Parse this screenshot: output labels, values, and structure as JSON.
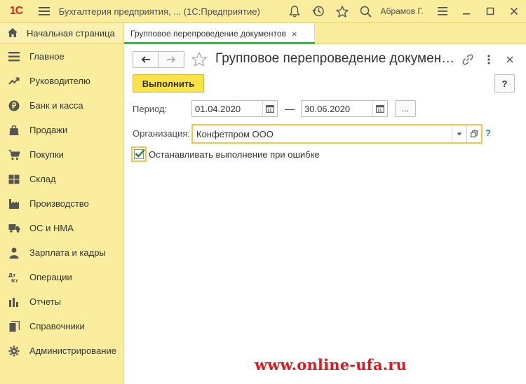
{
  "titlebar": {
    "logo": "1С",
    "title": "Бухгалтерия предприятия, ...  (1С:Предприятие)",
    "user": "Абрамов Г.",
    "icons": [
      "menu-icon",
      "bell-icon",
      "history-icon",
      "star-icon",
      "search-icon"
    ],
    "window_buttons": [
      "settings-icon",
      "minimize-icon",
      "maximize-icon",
      "close-icon"
    ]
  },
  "sidebar": {
    "home_label": "Начальная страница",
    "items": [
      {
        "label": "Главное",
        "icon": "list-icon"
      },
      {
        "label": "Руководителю",
        "icon": "trend-icon"
      },
      {
        "label": "Банк и касса",
        "icon": "ruble-icon"
      },
      {
        "label": "Продажи",
        "icon": "bag-icon"
      },
      {
        "label": "Покупки",
        "icon": "cart-icon"
      },
      {
        "label": "Склад",
        "icon": "warehouse-icon"
      },
      {
        "label": "Производство",
        "icon": "factory-icon"
      },
      {
        "label": "ОС и НМА",
        "icon": "truck-icon"
      },
      {
        "label": "Зарплата и кадры",
        "icon": "person-icon"
      },
      {
        "label": "Операции",
        "icon": "dt-kt-icon"
      },
      {
        "label": "Отчеты",
        "icon": "bar-chart-icon"
      },
      {
        "label": "Справочники",
        "icon": "books-icon"
      },
      {
        "label": "Администрирование",
        "icon": "gear-icon"
      }
    ]
  },
  "tabs": [
    {
      "label": "Групповое перепроведение документов",
      "close": "×"
    }
  ],
  "form": {
    "title": "Групповое перепроведение докумен…",
    "run_button": "Выполнить",
    "help_button": "?",
    "period_label": "Период:",
    "date_from": "01.04.2020",
    "date_to": "30.06.2020",
    "dash": "—",
    "ellipsis_button": "...",
    "org_label": "Организация:",
    "org_value": "Конфетпром ООО",
    "org_help": "?",
    "stop_on_error_label": "Останавливать выполнение при ошибке",
    "stop_on_error_checked": true
  },
  "colors": {
    "panel_bg": "#fbed9e",
    "run_button": "#fbe14a",
    "focus_border": "#f2c744",
    "tab_underline": "#4caf50",
    "checkmark": "#2e7d32",
    "watermark": "#e0191f"
  },
  "watermark": "www.online-ufa.ru"
}
